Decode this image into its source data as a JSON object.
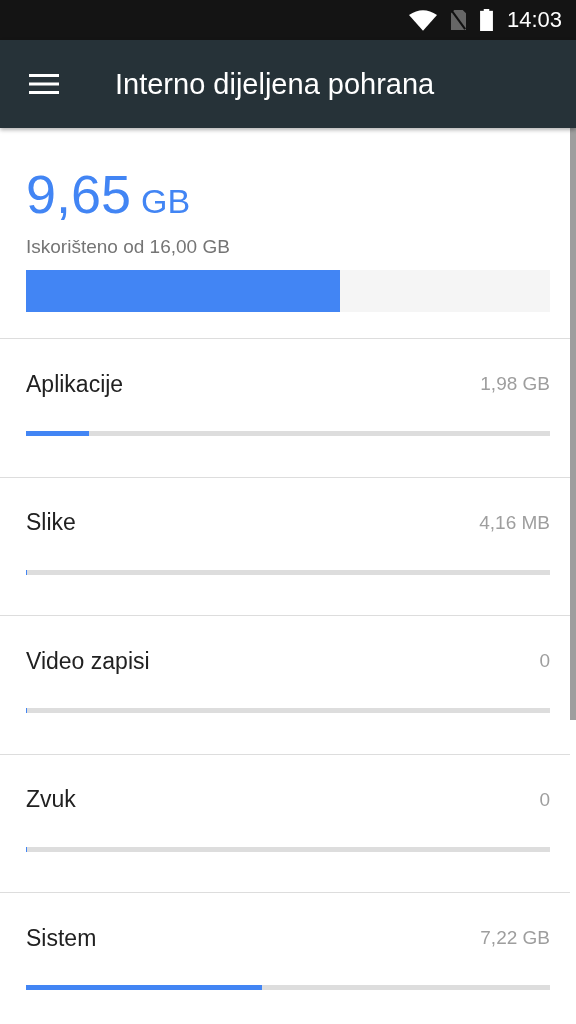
{
  "status_bar": {
    "time": "14:03"
  },
  "app_bar": {
    "title": "Interno dijeljena pohrana"
  },
  "summary": {
    "used": "9,65",
    "unit": "GB",
    "caption": "Iskorišteno od 16,00 GB",
    "level": 0.6
  },
  "categories": [
    {
      "name": "Aplikacije",
      "size": "1,98 GB",
      "level": 0.12
    },
    {
      "name": "Slike",
      "size": "4,16 MB",
      "level": 0
    },
    {
      "name": "Video zapisi",
      "size": "0",
      "level": 0
    },
    {
      "name": "Zvuk",
      "size": "0",
      "level": 0
    },
    {
      "name": "Sistem",
      "size": "7,22 GB",
      "level": 0.45
    }
  ]
}
